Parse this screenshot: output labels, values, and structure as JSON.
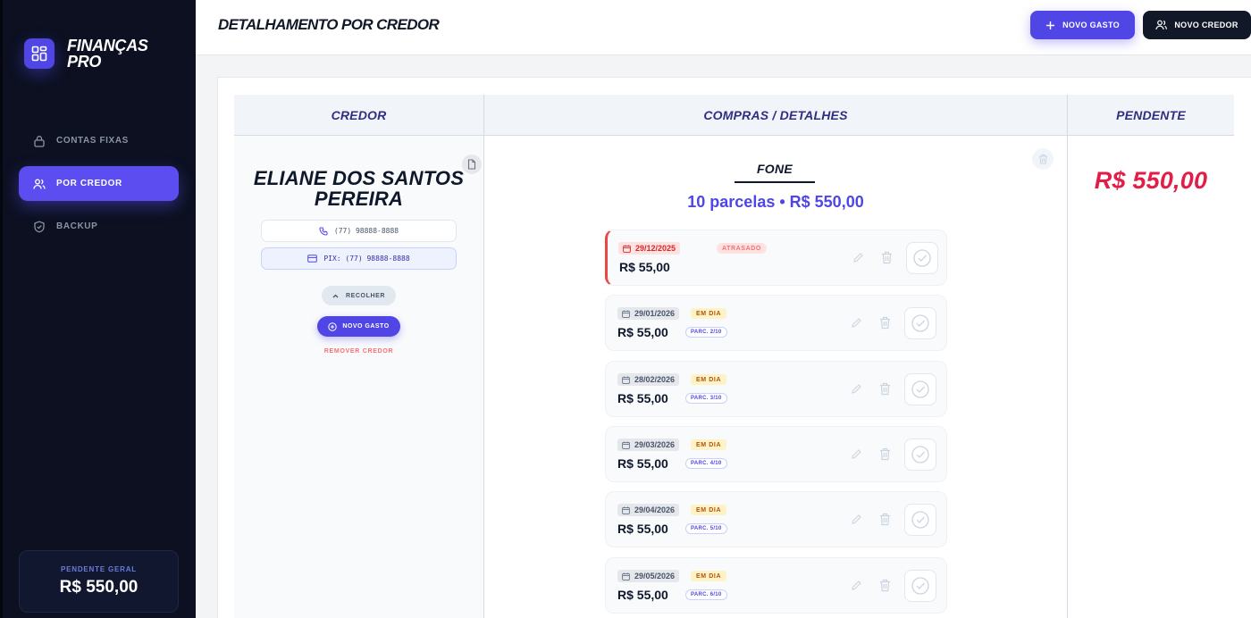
{
  "brand": {
    "name": "FINANÇAS PRO",
    "accent": "#4f46e5"
  },
  "sidebar": {
    "items": [
      {
        "label": "CONTAS FIXAS",
        "icon": "lock-icon",
        "active": false
      },
      {
        "label": "POR CREDOR",
        "icon": "users-icon",
        "active": true
      },
      {
        "label": "BACKUP",
        "icon": "shield-icon",
        "active": false
      }
    ],
    "pending": {
      "label": "PENDENTE GERAL",
      "value": "R$ 550,00"
    }
  },
  "header": {
    "title": "DETALHAMENTO POR CREDOR",
    "novo_gasto_label": "NOVO GASTO",
    "novo_credor_label": "NOVO CREDOR"
  },
  "table": {
    "headers": {
      "credor": "CREDOR",
      "compras": "COMPRAS / DETALHES",
      "pendente": "PENDENTE"
    },
    "credor": {
      "name": "ELIANE DOS SANTOS PEREIRA",
      "phone": "(77) 98888-8888",
      "pix": "PIX: (77) 98888-8888",
      "recolher_label": "RECOLHER",
      "novo_gasto_label": "NOVO GASTO",
      "remover_label": "REMOVER CREDOR"
    },
    "compra": {
      "name": "FONE",
      "summary": "10 parcelas • R$ 550,00",
      "parcelas": [
        {
          "date": "29/12/2025",
          "status": "ATRASADO",
          "value": "R$ 55,00",
          "parc": ""
        },
        {
          "date": "29/01/2026",
          "status": "EM DIA",
          "value": "R$ 55,00",
          "parc": "PARC. 2/10"
        },
        {
          "date": "28/02/2026",
          "status": "EM DIA",
          "value": "R$ 55,00",
          "parc": "PARC. 3/10"
        },
        {
          "date": "29/03/2026",
          "status": "EM DIA",
          "value": "R$ 55,00",
          "parc": "PARC. 4/10"
        },
        {
          "date": "29/04/2026",
          "status": "EM DIA",
          "value": "R$ 55,00",
          "parc": "PARC. 5/10"
        },
        {
          "date": "29/05/2026",
          "status": "EM DIA",
          "value": "R$ 55,00",
          "parc": "PARC. 6/10"
        }
      ]
    },
    "pendente": {
      "value": "R$ 550,00",
      "color": "#e11d48"
    }
  }
}
